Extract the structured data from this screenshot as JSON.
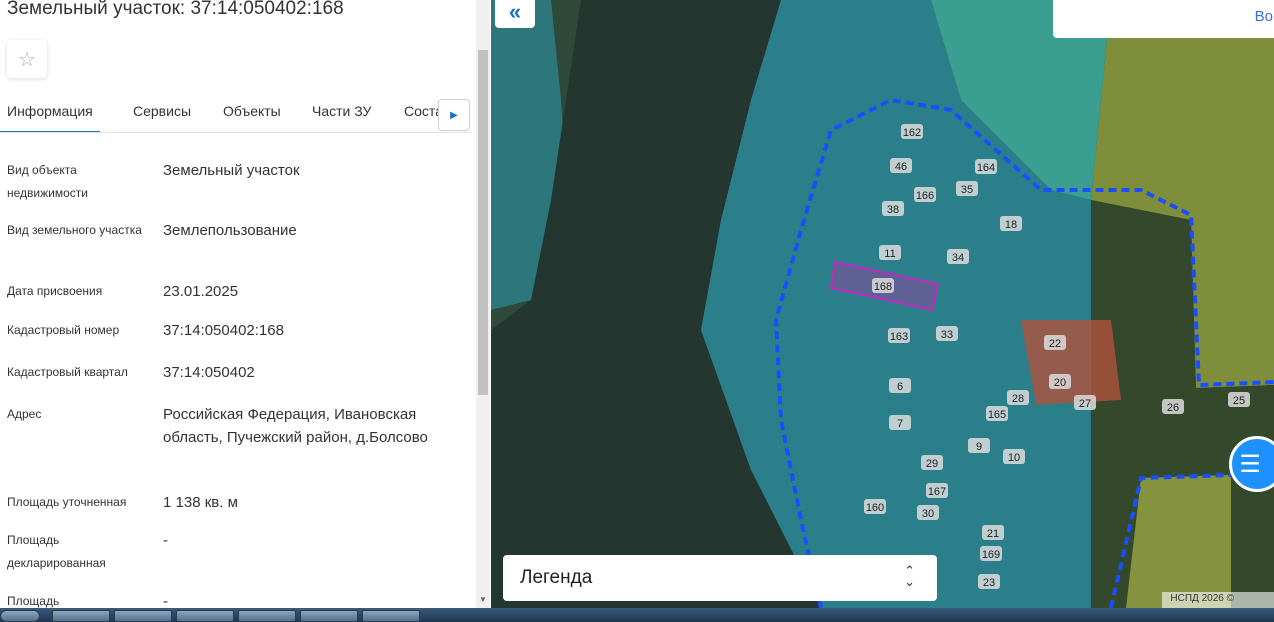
{
  "title": "Земельный участок: 37:14:050402:168",
  "tabs": [
    {
      "label": "Информация"
    },
    {
      "label": "Сервисы"
    },
    {
      "label": "Объекты"
    },
    {
      "label": "Части ЗУ"
    },
    {
      "label": "Состав"
    }
  ],
  "rows": [
    {
      "label": "Вид объекта недвижимости",
      "value": "Земельный участок"
    },
    {
      "label": "Вид земельного участка",
      "value": "Землепользование"
    },
    {
      "label": "Дата присвоения",
      "value": "23.01.2025"
    },
    {
      "label": "Кадастровый номер",
      "value": "37:14:050402:168"
    },
    {
      "label": "Кадастровый квартал",
      "value": "37:14:050402"
    },
    {
      "label": "Адрес",
      "value": "Российская Федерация, Ивановская область, Пучежский район, д.Болсово"
    },
    {
      "label": "Площадь уточненная",
      "value": "1 138 кв. м"
    },
    {
      "label": "Площадь декларированная",
      "value": "-"
    },
    {
      "label": "Площадь",
      "value": "-"
    }
  ],
  "map": {
    "collapse": "«",
    "topbox_text": "Во",
    "legend": "Легенда",
    "copyright": "НСПД 2026 ©",
    "parcels": [
      "162",
      "46",
      "164",
      "35",
      "166",
      "38",
      "18",
      "11",
      "34",
      "168",
      "163",
      "33",
      "22",
      "6",
      "20",
      "28",
      "27",
      "26",
      "25",
      "7",
      "165",
      "9",
      "10",
      "29",
      "167",
      "160",
      "30",
      "21",
      "169",
      "23"
    ]
  }
}
